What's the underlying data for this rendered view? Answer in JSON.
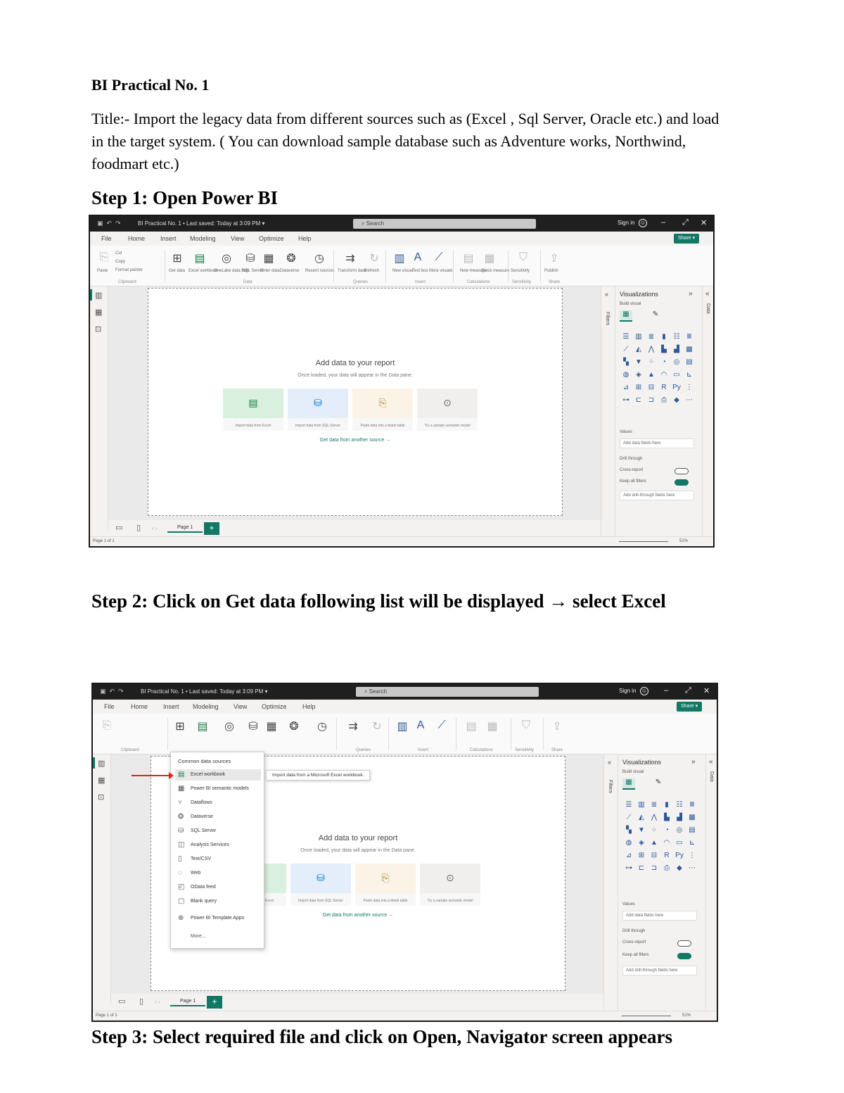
{
  "document": {
    "practical_title": "BI Practical No. 1",
    "title_paragraph": "Title:- Import the legacy data from different sources such as (Excel , Sql Server, Oracle etc.) and load in the target system. ( You can download sample database such as Adventure works, Northwind, foodmart etc.)",
    "step1": "Step 1: Open Power BI",
    "step2": "Step 2: Click on Get data following list will be displayed → select Excel",
    "step3": "Step 3: Select required file and click on Open, Navigator screen appears"
  },
  "screenshot1": {
    "file_title": "BI Practical No. 1 • Last saved: Today at 3:09 PM ▾",
    "search_placeholder": "Search",
    "sign_in": "Sign in",
    "share": "Share ▾",
    "menu": [
      "File",
      "Home",
      "Insert",
      "Modeling",
      "View",
      "Optimize",
      "Help"
    ],
    "ribbon_labels": [
      "Paste",
      "Get data",
      "Excel workbook",
      "OneLake data hub",
      "SQL Server",
      "Enter data",
      "Dataverse",
      "Recent sources",
      "Transform data",
      "Refresh",
      "New visual",
      "Text box",
      "More visuals",
      "New measure",
      "Quick measure",
      "Sensitivity",
      "Publish"
    ],
    "ribbon_groups": [
      "Clipboard",
      "Data",
      "Queries",
      "Insert",
      "Calculations",
      "Sensitivity",
      "Share"
    ],
    "clipboard_small": [
      "Cut",
      "Copy",
      "Format painter"
    ],
    "add_data_title": "Add data to your report",
    "add_data_sub": "Once loaded, your data will appear in the Data pane.",
    "cards": [
      "Import data from Excel",
      "Import data from SQL Server",
      "Paste data into a blank table",
      "Try a sample semantic model"
    ],
    "other_source": "Get data from another source →",
    "page_tab": "Page 1",
    "status_page": "Page 1 of 1",
    "zoom": "51%",
    "filters": "Filters",
    "visualizations": "Visualizations",
    "build_visual": "Build visual",
    "values_label": "Values",
    "values_box": "Add data fields here",
    "drill_through": "Drill through",
    "cross_report": "Cross-report",
    "cross_report_state": "Off",
    "keep_all_filters": "Keep all filters",
    "keep_all_filters_state": "On",
    "drill_box": "Add drill-through fields here",
    "data_pane": "Data"
  },
  "screenshot2": {
    "file_title": "BI Practical No. 1 • Last saved: Today at 3:09 PM ▾",
    "search_placeholder": "Search",
    "sign_in": "Sign in",
    "share": "Share ▾",
    "menu": [
      "File",
      "Home",
      "Insert",
      "Modeling",
      "View",
      "Optimize",
      "Help"
    ],
    "ribbon_groups": [
      "Clipboard",
      "Queries",
      "Insert",
      "Calculations",
      "Sensitivity",
      "Share"
    ],
    "dropdown_header": "Common data sources",
    "dropdown_items": [
      "Excel workbook",
      "Power BI semantic models",
      "Dataflows",
      "Dataverse",
      "SQL Server",
      "Analysis Services",
      "Text/CSV",
      "Web",
      "OData feed",
      "Blank query",
      "Power BI Template Apps"
    ],
    "dropdown_more": "More...",
    "tooltip": "Import data from a Microsoft Excel workbook.",
    "add_data_title": "Add data to your report",
    "add_data_sub": "Once loaded, your data will appear in the Data pane.",
    "cards": [
      "Import data from Excel",
      "Import data from SQL Server",
      "Paste data into a blank table",
      "Try a sample semantic model"
    ],
    "other_source": "Get data from another source →",
    "page_tab": "Page 1",
    "status_page": "Page 1 of 1",
    "zoom": "51%",
    "filters": "Filters",
    "visualizations": "Visualizations",
    "build_visual": "Build visual",
    "values_label": "Values",
    "values_box": "Add data fields here",
    "drill_through": "Drill through",
    "cross_report": "Cross-report",
    "keep_all_filters": "Keep all filters",
    "drill_box": "Add drill-through fields here",
    "data_pane": "Data"
  },
  "colors": {
    "accent": "#117865",
    "titlebar": "#1f1f1f",
    "excel_green": "#107c41",
    "arrow_red": "#e02020"
  }
}
